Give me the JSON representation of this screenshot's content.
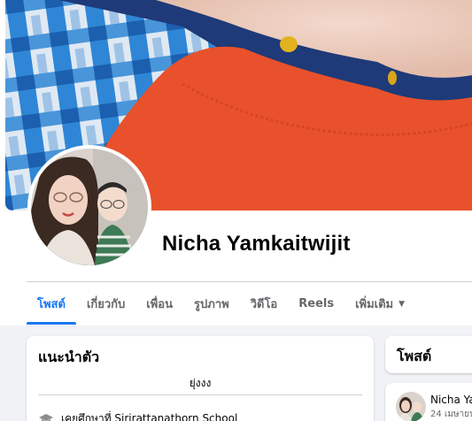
{
  "profile": {
    "name": "Nicha Yamkaitwijit"
  },
  "tabs": [
    {
      "label": "โพสต์",
      "active": true
    },
    {
      "label": "เกี่ยวกับ",
      "active": false
    },
    {
      "label": "เพื่อน",
      "active": false
    },
    {
      "label": "รูปภาพ",
      "active": false
    },
    {
      "label": "วิดีโอ",
      "active": false
    },
    {
      "label": "Reels",
      "active": false
    },
    {
      "label": "เพิ่มเติม",
      "active": false
    }
  ],
  "more_caret": "▼",
  "intro": {
    "title": "แนะนำตัว",
    "bio": "ยุ่งงง",
    "education": "เคยศึกษาที่ Sirirattanathorn School",
    "education_icon": "graduation-cap-icon"
  },
  "posts": {
    "title": "โพสต์",
    "latest_author": "Nicha Ya",
    "latest_date": "24 เมษายน"
  },
  "colors": {
    "accent": "#1877f2",
    "text_primary": "#050505",
    "text_secondary": "#65676b",
    "background": "#f0f2f5"
  }
}
